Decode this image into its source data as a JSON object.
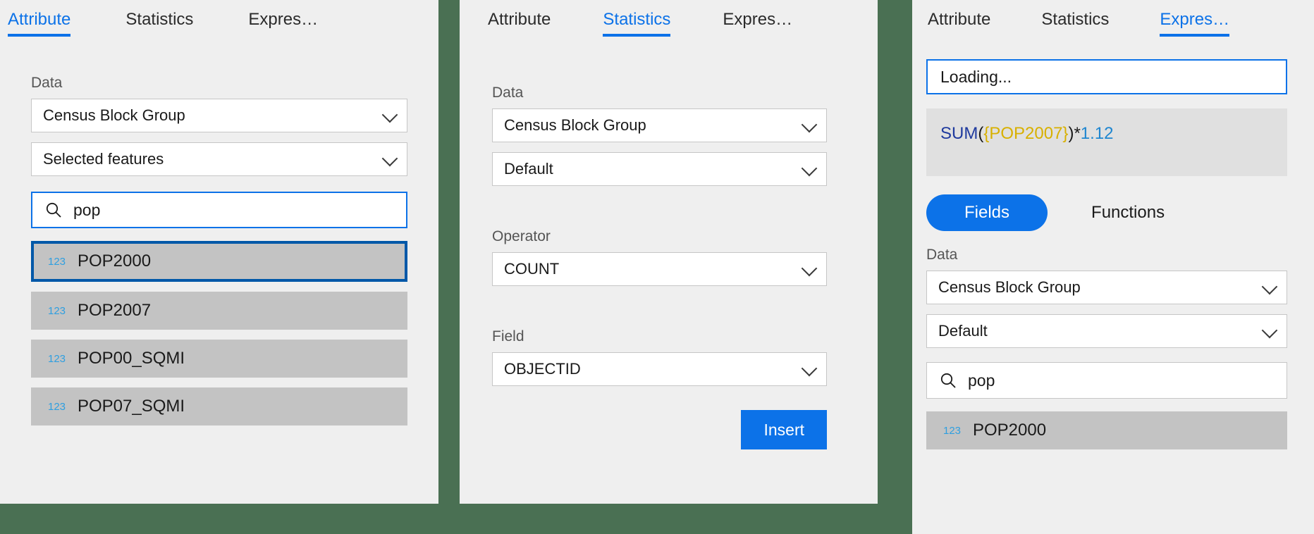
{
  "background_color": "#4a7053",
  "accent_color": "#0c72e8",
  "tabs": {
    "attribute": "Attribute",
    "statistics": "Statistics",
    "expression": "Expres…"
  },
  "attribute_panel": {
    "data_label": "Data",
    "layer_select": "Census Block Group",
    "scope_select": "Selected features",
    "search_value": "pop",
    "search_placeholder": "Search",
    "search_icon": "search-icon",
    "fields": [
      {
        "type_badge": "123",
        "name": "POP2000",
        "selected": true
      },
      {
        "type_badge": "123",
        "name": "POP2007",
        "selected": false
      },
      {
        "type_badge": "123",
        "name": "POP00_SQMI",
        "selected": false
      },
      {
        "type_badge": "123",
        "name": "POP07_SQMI",
        "selected": false
      }
    ]
  },
  "statistics_panel": {
    "data_label": "Data",
    "layer_select": "Census Block Group",
    "view_select": "Default",
    "operator_label": "Operator",
    "operator_select": "COUNT",
    "field_label": "Field",
    "field_select": "OBJECTID",
    "insert_button": "Insert"
  },
  "expression_panel": {
    "name_input_value": "Loading...",
    "name_input_placeholder": "Expression name",
    "expression_tokens": [
      {
        "text": "SUM",
        "kind": "fn"
      },
      {
        "text": "(",
        "kind": "punct"
      },
      {
        "text": "{POP2007}",
        "kind": "field"
      },
      {
        "text": ")*",
        "kind": "punct"
      },
      {
        "text": "1.12",
        "kind": "num"
      }
    ],
    "expression_plain": "SUM({POP2007})*1.12",
    "toggle_fields": "Fields",
    "toggle_functions": "Functions",
    "data_label": "Data",
    "layer_select": "Census Block Group",
    "view_select": "Default",
    "search_value": "pop",
    "search_placeholder": "Search",
    "fields": [
      {
        "type_badge": "123",
        "name": "POP2000",
        "selected": false
      }
    ]
  }
}
